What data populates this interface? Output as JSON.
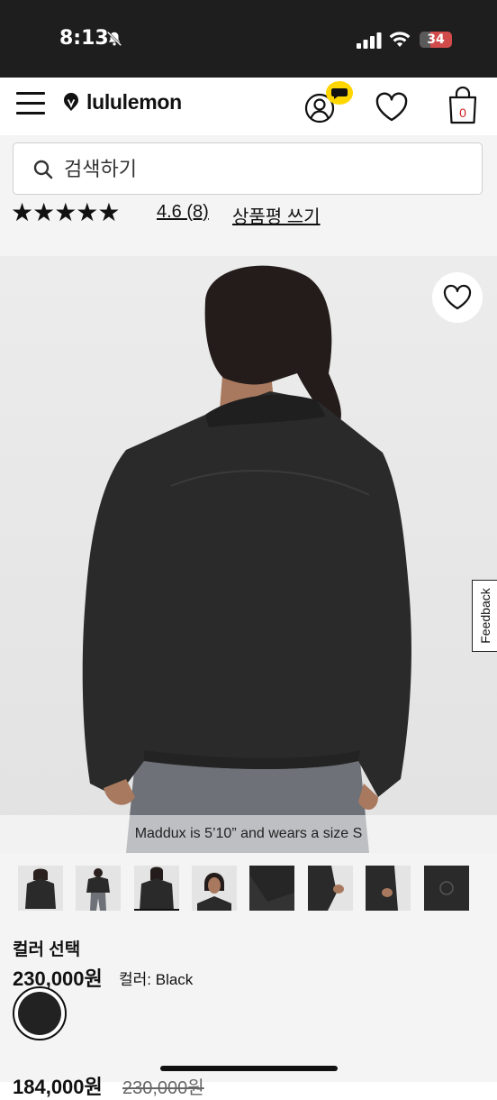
{
  "status_bar": {
    "time": "8:13",
    "battery": "34",
    "battery_level": 0.34
  },
  "header": {
    "brand": "lululemon",
    "cart_count": "0"
  },
  "search": {
    "placeholder": "검색하기"
  },
  "rating": {
    "stars": "★★★★★",
    "score": "4.6 (8)",
    "write_review": "상품평 쓰기"
  },
  "product_image": {
    "caption": "Maddux is 5’10” and wears a size S"
  },
  "feedback": {
    "label": "Feedback"
  },
  "thumbnails": {
    "count": 8,
    "selected_index": 2
  },
  "product_info": {
    "color_title": "컬러 선택",
    "price": "230,000원",
    "color_label": "컬러: Black",
    "sale_price": "184,000원",
    "original_price": "230,000원"
  },
  "colors": {
    "selected_swatch": "#222222",
    "brand_accent": "#d31c1c",
    "chat_badge": "#ffd600"
  }
}
